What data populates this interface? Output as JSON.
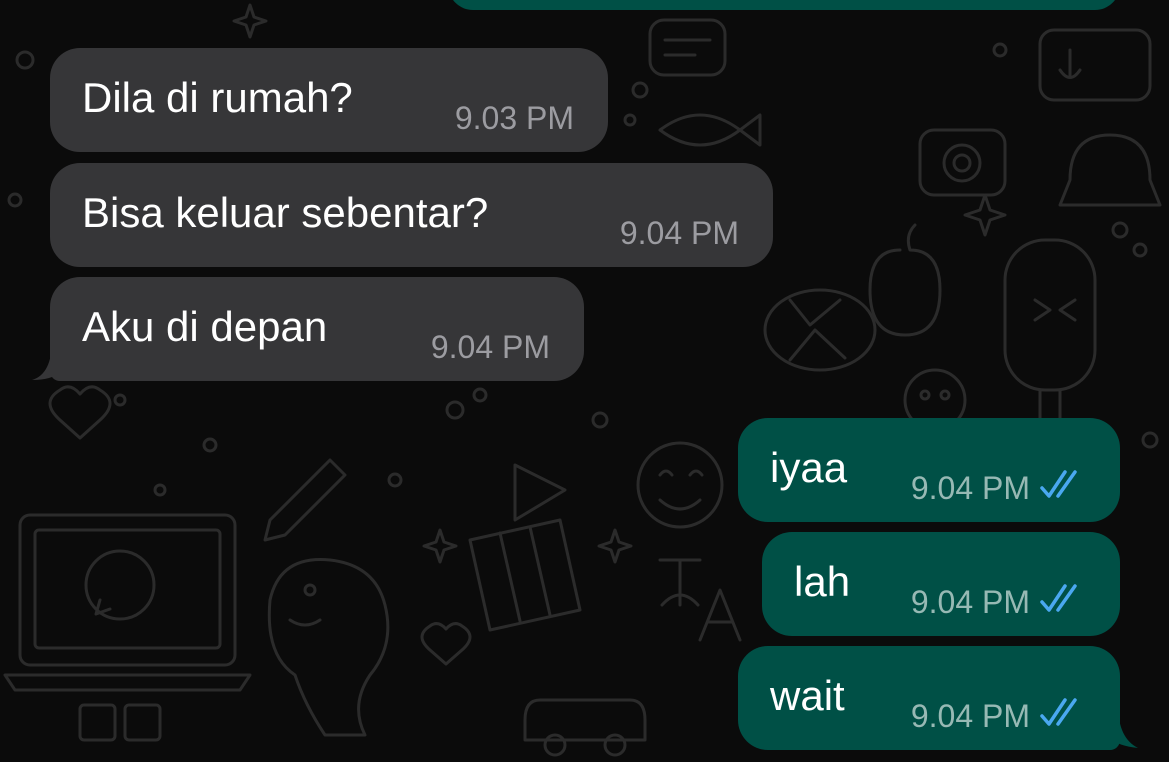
{
  "chat": {
    "colors": {
      "background": "#0b0b0b",
      "wallpaper_doodle": "#2b2b2b",
      "incoming_bubble": "#363638",
      "outgoing_bubble": "#005046",
      "text": "#ffffff",
      "incoming_time": "#9c9ca1",
      "outgoing_time": "#97b9b4",
      "read_ticks": "#4aa8f0"
    },
    "messages": [
      {
        "direction": "incoming",
        "text": "Dila di rumah?",
        "time": "9.03 PM"
      },
      {
        "direction": "incoming",
        "text": "Bisa keluar sebentar?",
        "time": "9.04 PM"
      },
      {
        "direction": "incoming",
        "text": "Aku di depan",
        "time": "9.04 PM"
      },
      {
        "direction": "outgoing",
        "text": "iyaa",
        "time": "9.04 PM",
        "status_icon": "double-check-read-icon"
      },
      {
        "direction": "outgoing",
        "text": "lah",
        "time": "9.04 PM",
        "status_icon": "double-check-read-icon"
      },
      {
        "direction": "outgoing",
        "text": "wait",
        "time": "9.04 PM",
        "status_icon": "double-check-read-icon"
      }
    ]
  }
}
